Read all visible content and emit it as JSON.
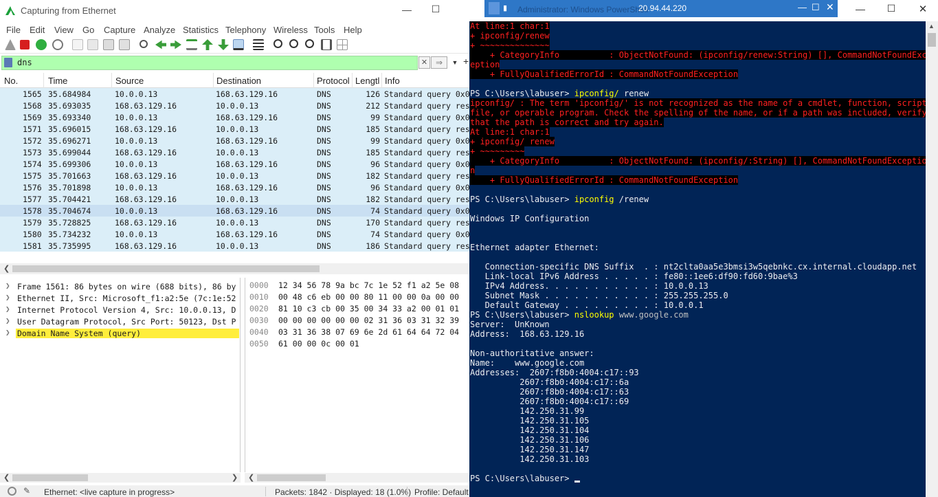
{
  "wireshark": {
    "title": "Capturing from Ethernet",
    "window_controls": {
      "minimize": "—",
      "maximize": "☐"
    },
    "menu": [
      "File",
      "Edit",
      "View",
      "Go",
      "Capture",
      "Analyze",
      "Statistics",
      "Telephony",
      "Wireless",
      "Tools",
      "Help"
    ],
    "filter": {
      "value": "dns",
      "clear": "✕",
      "apply": "⇒",
      "dropdown": "▼",
      "add": "+"
    },
    "columns": [
      "No.",
      "Time",
      "Source",
      "Destination",
      "Protocol",
      "Lengtl",
      "Info"
    ],
    "packets": [
      {
        "no": "1565",
        "time": "35.684984",
        "src": "10.0.0.13",
        "dst": "168.63.129.16",
        "proto": "DNS",
        "len": "126",
        "info": "Standard query 0x0"
      },
      {
        "no": "1568",
        "time": "35.693035",
        "src": "168.63.129.16",
        "dst": "10.0.0.13",
        "proto": "DNS",
        "len": "212",
        "info": "Standard query res"
      },
      {
        "no": "1569",
        "time": "35.693340",
        "src": "10.0.0.13",
        "dst": "168.63.129.16",
        "proto": "DNS",
        "len": "99",
        "info": "Standard query 0x0"
      },
      {
        "no": "1571",
        "time": "35.696015",
        "src": "168.63.129.16",
        "dst": "10.0.0.13",
        "proto": "DNS",
        "len": "185",
        "info": "Standard query res"
      },
      {
        "no": "1572",
        "time": "35.696271",
        "src": "10.0.0.13",
        "dst": "168.63.129.16",
        "proto": "DNS",
        "len": "99",
        "info": "Standard query 0x0"
      },
      {
        "no": "1573",
        "time": "35.699044",
        "src": "168.63.129.16",
        "dst": "10.0.0.13",
        "proto": "DNS",
        "len": "185",
        "info": "Standard query res"
      },
      {
        "no": "1574",
        "time": "35.699306",
        "src": "10.0.0.13",
        "dst": "168.63.129.16",
        "proto": "DNS",
        "len": "96",
        "info": "Standard query 0x0"
      },
      {
        "no": "1575",
        "time": "35.701663",
        "src": "168.63.129.16",
        "dst": "10.0.0.13",
        "proto": "DNS",
        "len": "182",
        "info": "Standard query res"
      },
      {
        "no": "1576",
        "time": "35.701898",
        "src": "10.0.0.13",
        "dst": "168.63.129.16",
        "proto": "DNS",
        "len": "96",
        "info": "Standard query 0x0"
      },
      {
        "no": "1577",
        "time": "35.704421",
        "src": "168.63.129.16",
        "dst": "10.0.0.13",
        "proto": "DNS",
        "len": "182",
        "info": "Standard query res"
      },
      {
        "no": "1578",
        "time": "35.704674",
        "src": "10.0.0.13",
        "dst": "168.63.129.16",
        "proto": "DNS",
        "len": "74",
        "info": "Standard query 0x0"
      },
      {
        "no": "1579",
        "time": "35.728825",
        "src": "168.63.129.16",
        "dst": "10.0.0.13",
        "proto": "DNS",
        "len": "170",
        "info": "Standard query res"
      },
      {
        "no": "1580",
        "time": "35.734232",
        "src": "10.0.0.13",
        "dst": "168.63.129.16",
        "proto": "DNS",
        "len": "74",
        "info": "Standard query 0x0"
      },
      {
        "no": "1581",
        "time": "35.735995",
        "src": "168.63.129.16",
        "dst": "10.0.0.13",
        "proto": "DNS",
        "len": "186",
        "info": "Standard query res"
      }
    ],
    "details": [
      "Frame 1561: 86 bytes on wire (688 bits), 86 by",
      "Ethernet II, Src: Microsoft_f1:a2:5e (7c:1e:52",
      "Internet Protocol Version 4, Src: 10.0.0.13, D",
      "User Datagram Protocol, Src Port: 50123, Dst P",
      "Domain Name System (query)"
    ],
    "hex": [
      {
        "off": "0000",
        "bytes": "12 34 56 78 9a bc 7c 1e  52 f1 a2 5e 08"
      },
      {
        "off": "0010",
        "bytes": "00 48 c6 eb 00 00 80 11  00 00 0a 00 00"
      },
      {
        "off": "0020",
        "bytes": "81 10 c3 cb 00 35 00 34  33 a2 00 01 01"
      },
      {
        "off": "0030",
        "bytes": "00 00 00 00 00 00 02 31  36 03 31 32 39"
      },
      {
        "off": "0040",
        "bytes": "03 31 36 38 07 69 6e 2d  61 64 64 72 04"
      },
      {
        "off": "0050",
        "bytes": "61 00 00 0c 00 01"
      }
    ],
    "status": {
      "interface": "Ethernet: <live capture in progress>",
      "packets": "Packets: 1842 · Displayed: 18 (1.0%)",
      "profile": "Profile: Default"
    }
  },
  "powershell": {
    "title": "Administrator: Windows PowerShell",
    "ip": "20.94.44.220",
    "window_controls": {
      "minimize": "—",
      "maximize": "☐",
      "close": "✕"
    },
    "lines": [
      {
        "parts": [
          {
            "t": "At line:1 char:1",
            "c": "err"
          }
        ]
      },
      {
        "parts": [
          {
            "t": "+ ipconfig/renew",
            "c": "err"
          }
        ]
      },
      {
        "parts": [
          {
            "t": "+ ~~~~~~~~~~~~~~",
            "c": "err"
          }
        ]
      },
      {
        "parts": [
          {
            "t": "    + CategoryInfo          : ObjectNotFound: (ipconfig/renew:String) [], CommandNotFoundExc",
            "c": "err"
          }
        ]
      },
      {
        "parts": [
          {
            "t": "eption",
            "c": "err"
          }
        ]
      },
      {
        "parts": [
          {
            "t": "    + FullyQualifiedErrorId : CommandNotFoundException",
            "c": "err"
          }
        ]
      },
      {
        "parts": []
      },
      {
        "parts": [
          {
            "t": "PS C:\\Users\\labuser> ",
            "c": ""
          },
          {
            "t": "ipconfig/",
            "c": "cmd"
          },
          {
            "t": " renew",
            "c": ""
          }
        ]
      },
      {
        "parts": [
          {
            "t": "ipconfig/ : The term 'ipconfig/' is not recognized as the name of a cmdlet, function, script",
            "c": "err"
          }
        ]
      },
      {
        "parts": [
          {
            "t": "file, or operable program. Check the spelling of the name, or if a path was included, verify",
            "c": "err"
          }
        ]
      },
      {
        "parts": [
          {
            "t": "that the path is correct and try again.",
            "c": "err"
          }
        ]
      },
      {
        "parts": [
          {
            "t": "At line:1 char:1",
            "c": "err"
          }
        ]
      },
      {
        "parts": [
          {
            "t": "+ ipconfig/ renew",
            "c": "err"
          }
        ]
      },
      {
        "parts": [
          {
            "t": "+ ~~~~~~~~~",
            "c": "err"
          }
        ]
      },
      {
        "parts": [
          {
            "t": "    + CategoryInfo          : ObjectNotFound: (ipconfig/:String) [], CommandNotFoundExceptio",
            "c": "err"
          }
        ]
      },
      {
        "parts": [
          {
            "t": "n",
            "c": "err"
          }
        ]
      },
      {
        "parts": [
          {
            "t": "    + FullyQualifiedErrorId : CommandNotFoundException",
            "c": "err"
          }
        ]
      },
      {
        "parts": []
      },
      {
        "parts": [
          {
            "t": "PS C:\\Users\\labuser> ",
            "c": ""
          },
          {
            "t": "ipconfig",
            "c": "cmd"
          },
          {
            "t": " /renew",
            "c": ""
          }
        ]
      },
      {
        "parts": []
      },
      {
        "parts": [
          {
            "t": "Windows IP Configuration",
            "c": ""
          }
        ]
      },
      {
        "parts": []
      },
      {
        "parts": []
      },
      {
        "parts": [
          {
            "t": "Ethernet adapter Ethernet:",
            "c": ""
          }
        ]
      },
      {
        "parts": []
      },
      {
        "parts": [
          {
            "t": "   Connection-specific DNS Suffix  . : nt2clta0aa5e3bmsi3w5qebnkc.cx.internal.cloudapp.net",
            "c": ""
          }
        ]
      },
      {
        "parts": [
          {
            "t": "   Link-local IPv6 Address . . . . . : fe80::1ee6:df90:fd60:9bae%3",
            "c": ""
          }
        ]
      },
      {
        "parts": [
          {
            "t": "   IPv4 Address. . . . . . . . . . . : 10.0.0.13",
            "c": ""
          }
        ]
      },
      {
        "parts": [
          {
            "t": "   Subnet Mask . . . . . . . . . . . : 255.255.255.0",
            "c": ""
          }
        ]
      },
      {
        "parts": [
          {
            "t": "   Default Gateway . . . . . . . . . : 10.0.0.1",
            "c": ""
          }
        ]
      },
      {
        "parts": [
          {
            "t": "PS C:\\Users\\labuser> ",
            "c": ""
          },
          {
            "t": "nslookup",
            "c": "cmd"
          },
          {
            "t": " www.google.com",
            "c": "arg"
          }
        ]
      },
      {
        "parts": [
          {
            "t": "Server:  UnKnown",
            "c": ""
          }
        ]
      },
      {
        "parts": [
          {
            "t": "Address:  168.63.129.16",
            "c": ""
          }
        ]
      },
      {
        "parts": []
      },
      {
        "parts": [
          {
            "t": "Non-authoritative answer:",
            "c": ""
          }
        ]
      },
      {
        "parts": [
          {
            "t": "Name:    www.google.com",
            "c": ""
          }
        ]
      },
      {
        "parts": [
          {
            "t": "Addresses:  2607:f8b0:4004:c17::93",
            "c": ""
          }
        ]
      },
      {
        "parts": [
          {
            "t": "          2607:f8b0:4004:c17::6a",
            "c": ""
          }
        ]
      },
      {
        "parts": [
          {
            "t": "          2607:f8b0:4004:c17::63",
            "c": ""
          }
        ]
      },
      {
        "parts": [
          {
            "t": "          2607:f8b0:4004:c17::69",
            "c": ""
          }
        ]
      },
      {
        "parts": [
          {
            "t": "          142.250.31.99",
            "c": ""
          }
        ]
      },
      {
        "parts": [
          {
            "t": "          142.250.31.105",
            "c": ""
          }
        ]
      },
      {
        "parts": [
          {
            "t": "          142.250.31.104",
            "c": ""
          }
        ]
      },
      {
        "parts": [
          {
            "t": "          142.250.31.106",
            "c": ""
          }
        ]
      },
      {
        "parts": [
          {
            "t": "          142.250.31.147",
            "c": ""
          }
        ]
      },
      {
        "parts": [
          {
            "t": "          142.250.31.103",
            "c": ""
          }
        ]
      },
      {
        "parts": []
      },
      {
        "parts": [
          {
            "t": "PS C:\\Users\\labuser> ",
            "c": ""
          }
        ],
        "cursor": true
      }
    ]
  }
}
